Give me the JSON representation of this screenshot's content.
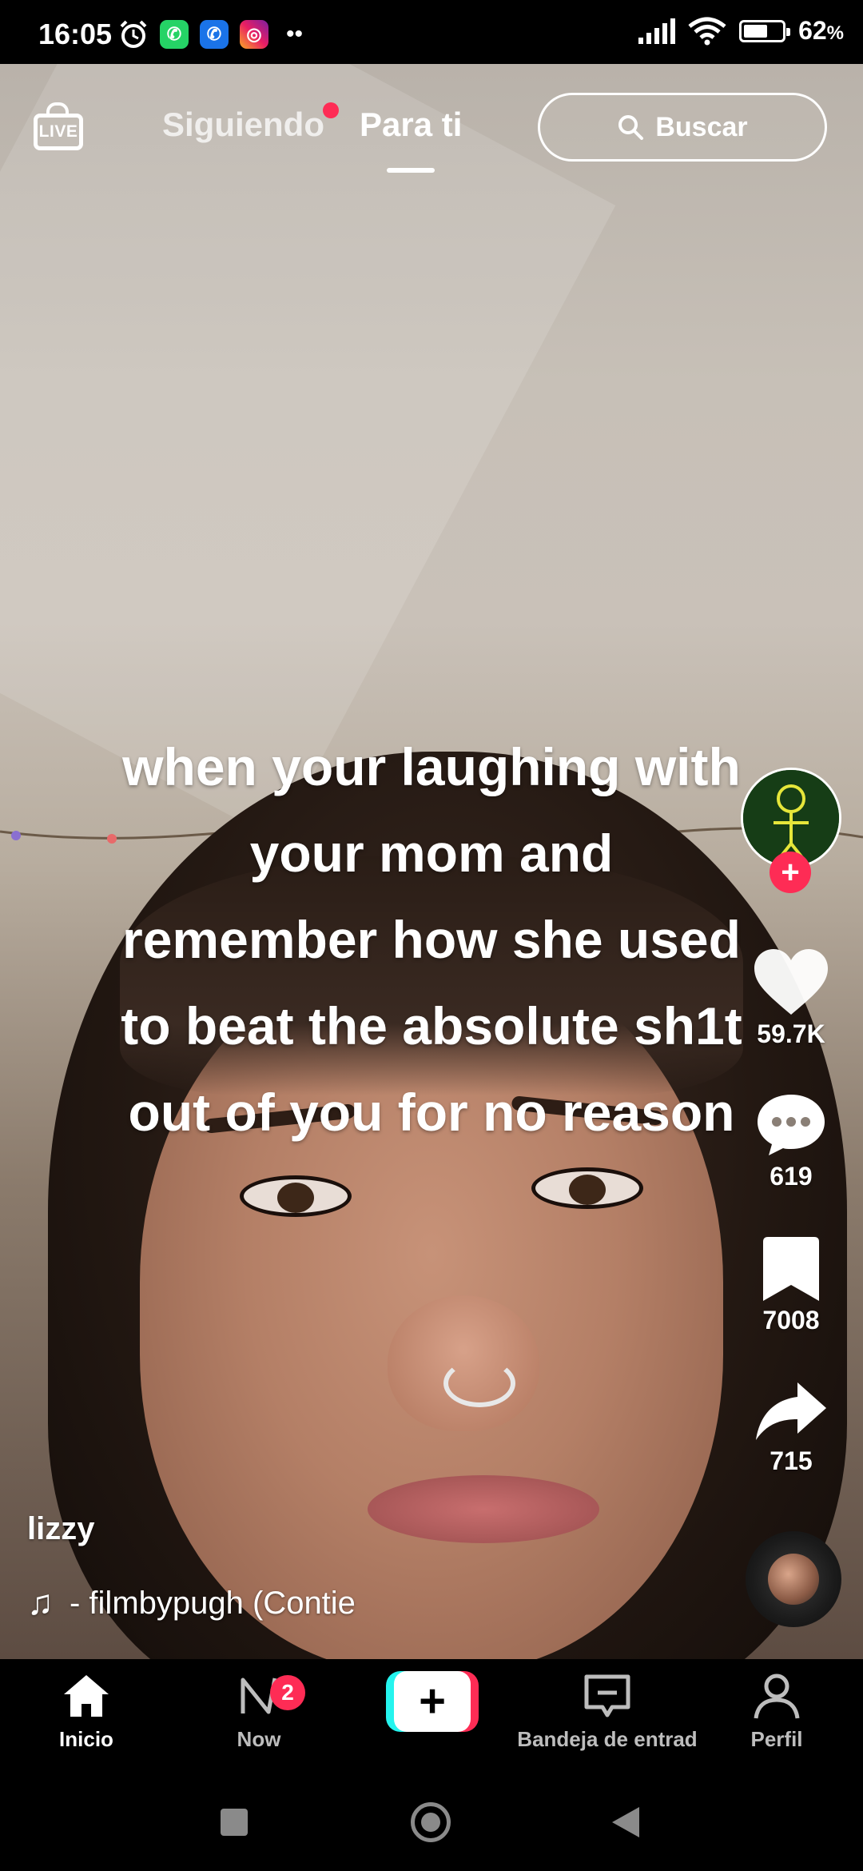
{
  "status_bar": {
    "time": "16:05",
    "battery": "62",
    "battery_unit": "%",
    "battery_level": 0.62,
    "app_icons": [
      "alarm-icon",
      "whatsapp-icon",
      "phone-icon",
      "instagram-icon",
      "more-dots-icon"
    ]
  },
  "top_nav": {
    "live_label": "LIVE",
    "tabs": [
      {
        "label": "Siguiendo",
        "active": false,
        "has_dot": true
      },
      {
        "label": "Para ti",
        "active": true
      }
    ],
    "search_label": "Buscar"
  },
  "video": {
    "caption_lines": [
      "when your laughing with",
      "your mom and",
      "remember how she used",
      "to beat the absolute sh1t",
      "out of you for no reason"
    ]
  },
  "actions": {
    "likes": "59.7K",
    "comments": "619",
    "saves": "7008",
    "shares": "715"
  },
  "post": {
    "author": "lizzy",
    "sound": "- filmbypugh (Contie"
  },
  "tab_bar": {
    "home": "Inicio",
    "now": "Now",
    "now_badge": "2",
    "create": "+",
    "inbox": "Bandeja de entrad",
    "profile": "Perfil"
  },
  "colors": {
    "accent": "#fe2c55",
    "cyan": "#25f4ee"
  }
}
